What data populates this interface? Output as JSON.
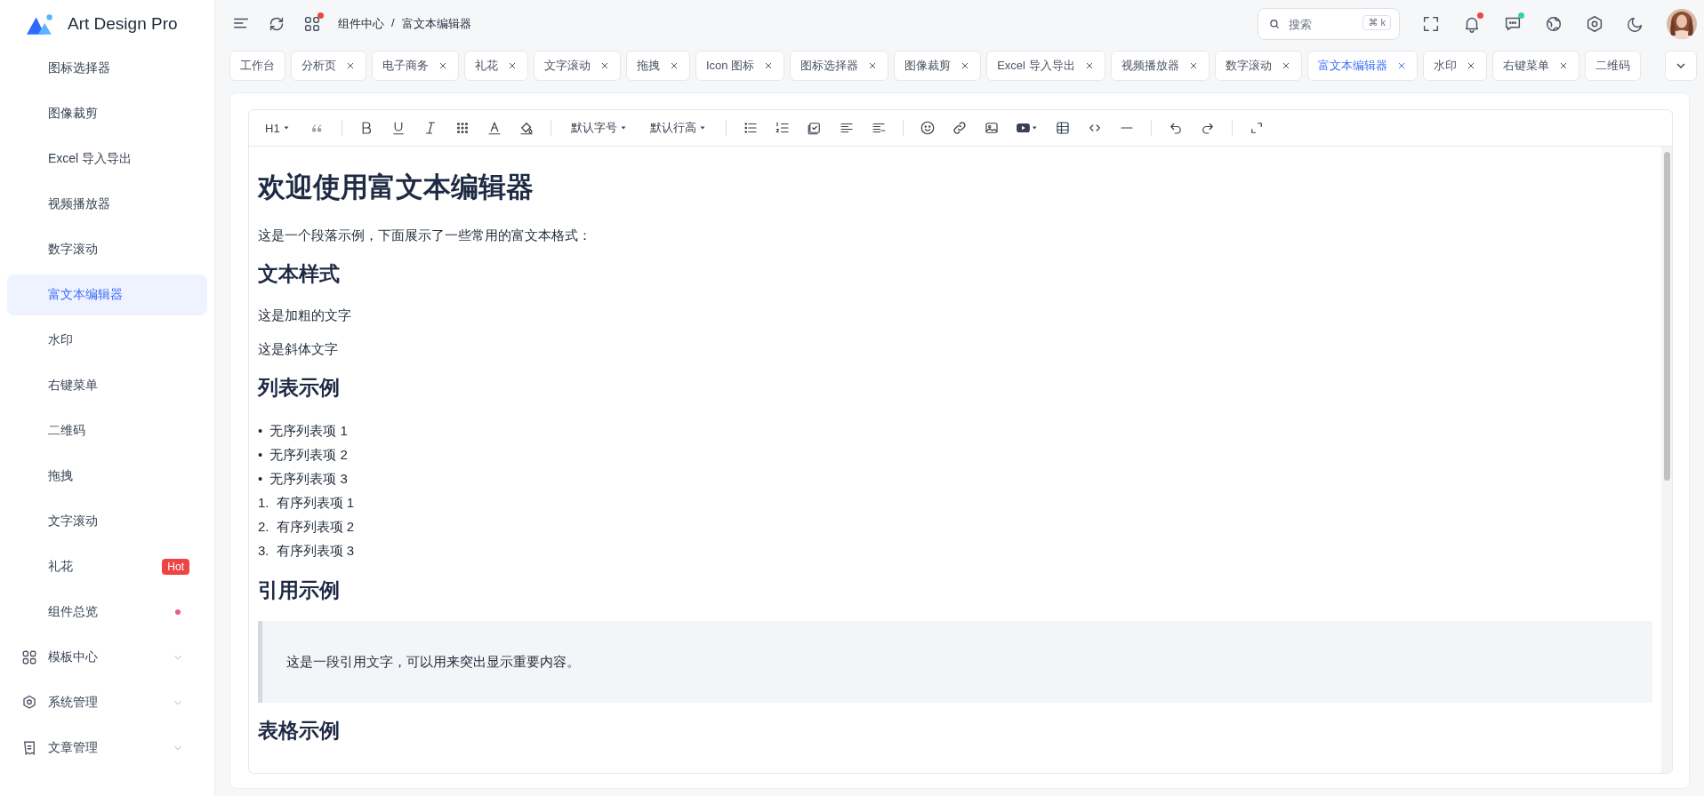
{
  "logo": {
    "title": "Art Design Pro"
  },
  "sidebar": {
    "items": [
      {
        "kind": "sub",
        "label": "图标选择器",
        "selected": false
      },
      {
        "kind": "sub",
        "label": "图像裁剪",
        "selected": false
      },
      {
        "kind": "sub",
        "label": "Excel 导入导出",
        "selected": false
      },
      {
        "kind": "sub",
        "label": "视频播放器",
        "selected": false
      },
      {
        "kind": "sub",
        "label": "数字滚动",
        "selected": false
      },
      {
        "kind": "sub",
        "label": "富文本编辑器",
        "selected": true
      },
      {
        "kind": "sub",
        "label": "水印",
        "selected": false
      },
      {
        "kind": "sub",
        "label": "右键菜单",
        "selected": false
      },
      {
        "kind": "sub",
        "label": "二维码",
        "selected": false
      },
      {
        "kind": "sub",
        "label": "拖拽",
        "selected": false
      },
      {
        "kind": "sub",
        "label": "文字滚动",
        "selected": false
      },
      {
        "kind": "sub",
        "label": "礼花",
        "selected": false,
        "badge": "Hot"
      },
      {
        "kind": "sub",
        "label": "组件总览",
        "selected": false,
        "dot": true
      },
      {
        "kind": "group",
        "label": "模板中心",
        "selected": false,
        "expanded": false
      },
      {
        "kind": "group",
        "label": "系统管理",
        "selected": false,
        "expanded": false
      },
      {
        "kind": "group",
        "label": "文章管理",
        "selected": false,
        "expanded": false
      }
    ]
  },
  "header": {
    "apps_unread": true,
    "breadcrumb": {
      "items": [
        "组件中心",
        "富文本编辑器"
      ],
      "separator": "/"
    },
    "search": {
      "placeholder": "搜索",
      "shortcut": "⌘ k"
    },
    "bell_unread": true,
    "chat_unread": true
  },
  "tabs": [
    {
      "label": "工作台",
      "selected": false,
      "closable": false
    },
    {
      "label": "分析页",
      "selected": false,
      "closable": true
    },
    {
      "label": "电子商务",
      "selected": false,
      "closable": true
    },
    {
      "label": "礼花",
      "selected": false,
      "closable": true
    },
    {
      "label": "文字滚动",
      "selected": false,
      "closable": true
    },
    {
      "label": "拖拽",
      "selected": false,
      "closable": true
    },
    {
      "label": "Icon 图标",
      "selected": false,
      "closable": true
    },
    {
      "label": "图标选择器",
      "selected": false,
      "closable": true
    },
    {
      "label": "图像裁剪",
      "selected": false,
      "closable": true
    },
    {
      "label": "Excel 导入导出",
      "selected": false,
      "closable": true
    },
    {
      "label": "视频播放器",
      "selected": false,
      "closable": true
    },
    {
      "label": "数字滚动",
      "selected": false,
      "closable": true
    },
    {
      "label": "富文本编辑器",
      "selected": true,
      "closable": true
    },
    {
      "label": "水印",
      "selected": false,
      "closable": true
    },
    {
      "label": "右键菜单",
      "selected": false,
      "closable": true
    },
    {
      "label": "二维码",
      "selected": false,
      "closable": false
    }
  ],
  "editor": {
    "toolbar": {
      "heading": "H1",
      "font_size": "默认字号",
      "line_height": "默认行高"
    },
    "content": [
      {
        "kind": "h1",
        "text": "欢迎使用富文本编辑器"
      },
      {
        "kind": "p",
        "text": "这是一个段落示例，下面展示了一些常用的富文本格式："
      },
      {
        "kind": "h2",
        "text": "文本样式"
      },
      {
        "kind": "p",
        "text": "这是加粗的文字"
      },
      {
        "kind": "p",
        "text": "这是斜体文字"
      },
      {
        "kind": "h2",
        "text": "列表示例"
      },
      {
        "kind": "list",
        "items": [
          {
            "marker": "•",
            "text": "无序列表项 1"
          },
          {
            "marker": "•",
            "text": "无序列表项 2"
          },
          {
            "marker": "•",
            "text": "无序列表项 3"
          },
          {
            "marker": "1.",
            "text": "有序列表项 1"
          },
          {
            "marker": "2.",
            "text": "有序列表项 2"
          },
          {
            "marker": "3.",
            "text": "有序列表项 3"
          }
        ]
      },
      {
        "kind": "h2",
        "text": "引用示例"
      },
      {
        "kind": "quote",
        "text": "这是一段引用文字，可以用来突出显示重要内容。"
      },
      {
        "kind": "h2",
        "text": "表格示例"
      }
    ]
  }
}
